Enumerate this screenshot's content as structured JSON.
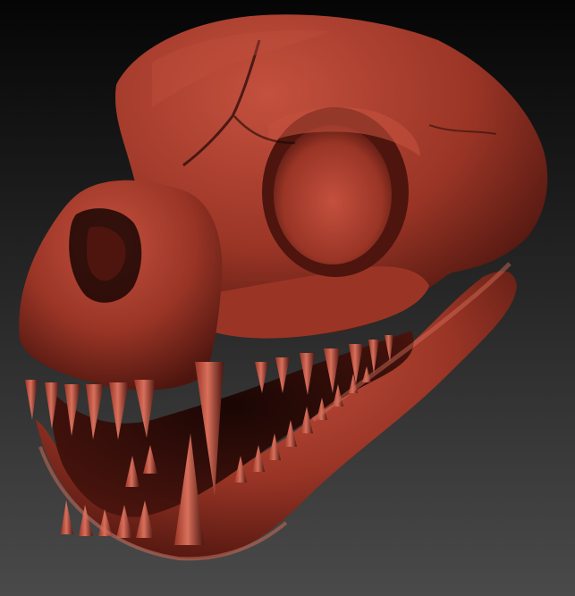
{
  "scene": {
    "subject": "skull-sculpt",
    "colors": {
      "background_top": "#050505",
      "background_bottom": "#4a4a4a",
      "bone_light": "#c4503e",
      "bone_mid": "#9a3526",
      "bone_dark": "#4d150e",
      "tooth_light": "#d8705c",
      "shadow": "#1a0604"
    }
  }
}
